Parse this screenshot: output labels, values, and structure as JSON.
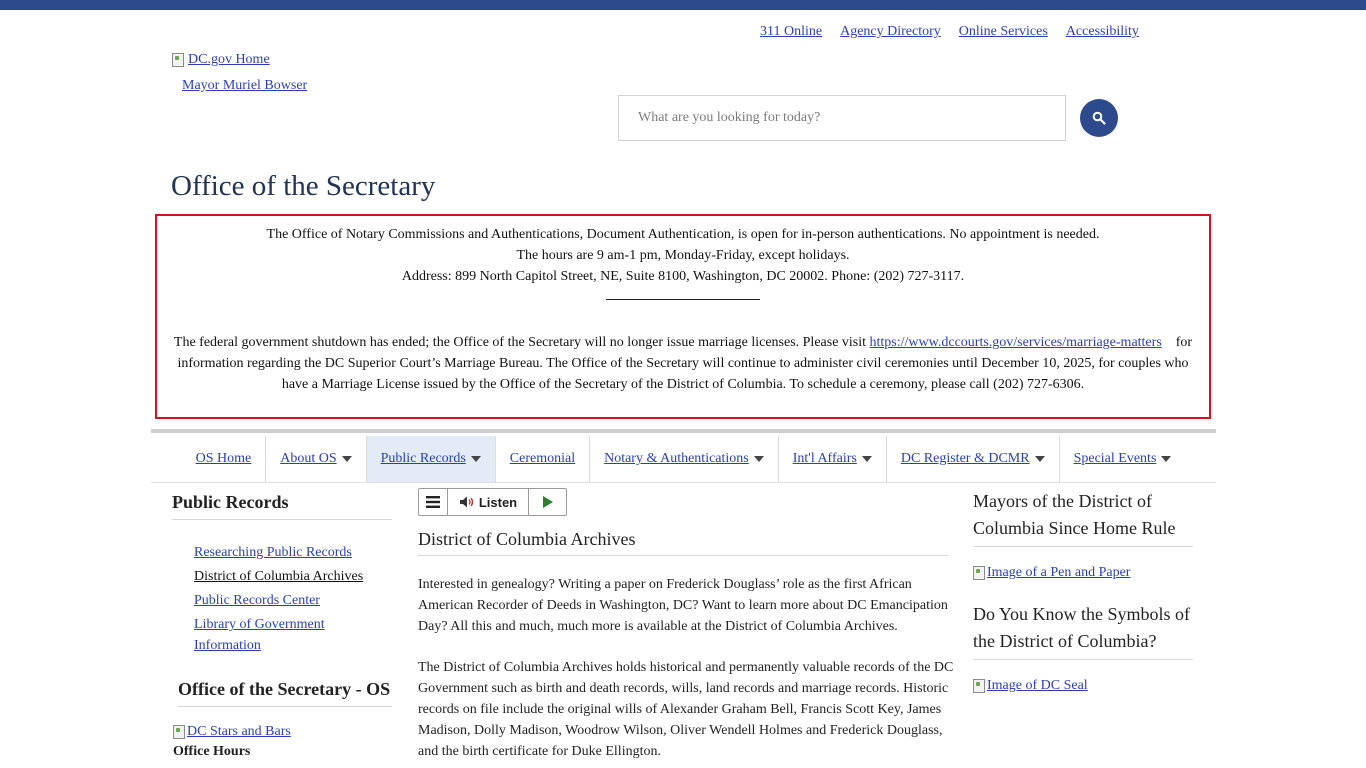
{
  "utility_links": [
    "311 Online",
    "Agency Directory",
    "Online Services",
    "Accessibility"
  ],
  "header": {
    "logo_alt": "DC.gov Home",
    "mayor_link": "Mayor Muriel Bowser",
    "search_placeholder": "What are you looking for today?",
    "search_icon": "search-icon"
  },
  "page_title": "Office of the Secretary",
  "alert": {
    "line1": "The Office of Notary Commissions and Authentications, Document Authentication, is open for in-person authentications. No appointment is needed.",
    "line2": "The hours are 9 am-1 pm, Monday-Friday, except holidays.",
    "line3": "Address: 899 North Capitol Street, NE, Suite 8100, Washington, DC 20002. Phone: (202) 727-3117.",
    "para_before_link": "The federal government shutdown has ended; the Office of the Secretary will no longer issue marriage licenses.  Please visit ",
    "link_text": "https://www.dccourts.gov/services/marriage-matters",
    "para_after_link": "    for information regarding the DC Superior Court’s Marriage Bureau. The Office of the Secretary will continue to administer civil ceremonies until December 10, 2025, for couples who have a Marriage License issued by the Office of the Secretary of the District of Columbia. To schedule a ceremony, please call (202) 727-6306.",
    "border_color": "#d5121e"
  },
  "nav": {
    "items": [
      {
        "label": "OS Home",
        "dropdown": false
      },
      {
        "label": "About OS",
        "dropdown": true
      },
      {
        "label": "Public Records",
        "dropdown": true,
        "active": true
      },
      {
        "label": "Ceremonial",
        "dropdown": false
      },
      {
        "label": "Notary & Authentications",
        "dropdown": true
      },
      {
        "label": "Int'l Affairs",
        "dropdown": true
      },
      {
        "label": "DC Register & DCMR",
        "dropdown": true
      },
      {
        "label": "Special Events",
        "dropdown": true
      }
    ]
  },
  "left": {
    "heading": "Public Records",
    "links": [
      "Researching Public Records",
      "District of Columbia Archives",
      "Public Records Center",
      "Library of Government Information"
    ],
    "current_index": 1,
    "heading2": "Office of the Secretary - OS",
    "image_alt": "DC Stars and Bars",
    "office_hours": "Office Hours"
  },
  "listen_bar": {
    "label": "Listen",
    "menu_icon": "menu-icon",
    "speaker_icon": "speaker-icon",
    "play_icon": "play-icon"
  },
  "main": {
    "heading": "District of Columbia Archives",
    "p1": "Interested in genealogy? Writing a paper on Frederick Douglass’ role as the first African American Recorder of Deeds in Washington, DC? Want to learn more about DC Emancipation Day? All this and much, much more is available at the District of Columbia Archives.",
    "p2": "The District of Columbia Archives holds historical and permanently valuable records of the DC Government such as birth and death records, wills, land records and marriage records. Historic records on file include the original wills of Alexander Graham Bell, Francis Scott Key, James Madison, Dolly Madison, Woodrow Wilson, Oliver Wendell Holmes and Frederick Douglass, and the birth certificate for Duke Ellington."
  },
  "right": {
    "heading1": "Mayors of the District of Columbia Since Home Rule",
    "image1_alt": "Image of a Pen and Paper",
    "heading2": "Do You Know the Symbols of the District of Columbia?",
    "image2_alt": "Image of DC Seal"
  },
  "colors": {
    "brand_blue": "#2c4a8c",
    "link": "#2b3eb8",
    "nav_active_bg": "#e3ebf7"
  }
}
